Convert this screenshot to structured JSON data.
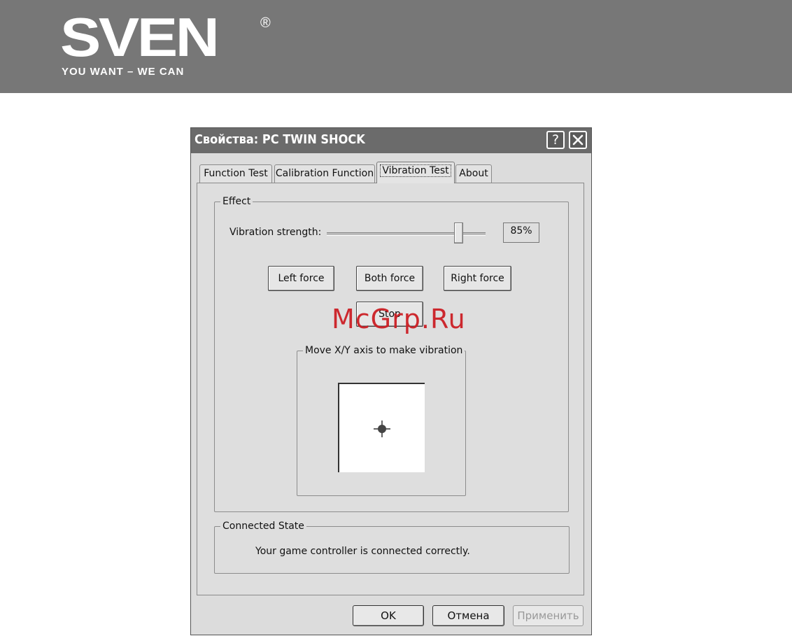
{
  "brand": {
    "logo": "SVEN",
    "registered": "®",
    "slogan": "YOU WANT – WE CAN"
  },
  "window": {
    "title": "Свойства: PC TWIN SHOCK",
    "help_button": "?",
    "close_button": "✕"
  },
  "tabs": [
    {
      "label": "Function Test",
      "active": false
    },
    {
      "label": "Calibration Function",
      "active": false
    },
    {
      "label": "Vibration Test",
      "active": true
    },
    {
      "label": "About",
      "active": false
    }
  ],
  "effect": {
    "group_label": "Effect",
    "strength_label": "Vibration strength:",
    "strength_value": "85%",
    "strength_fraction": 0.85,
    "buttons": {
      "left": "Left force",
      "both": "Both force",
      "right": "Right force",
      "stop": "Stop"
    },
    "xy_group_label": "Move X/Y axis to make vibration"
  },
  "connected": {
    "group_label": "Connected State",
    "message": "Your game controller is connected correctly."
  },
  "footer": {
    "ok": "OK",
    "cancel": "Отмена",
    "apply": "Применить"
  },
  "watermark": "McGrp.Ru"
}
